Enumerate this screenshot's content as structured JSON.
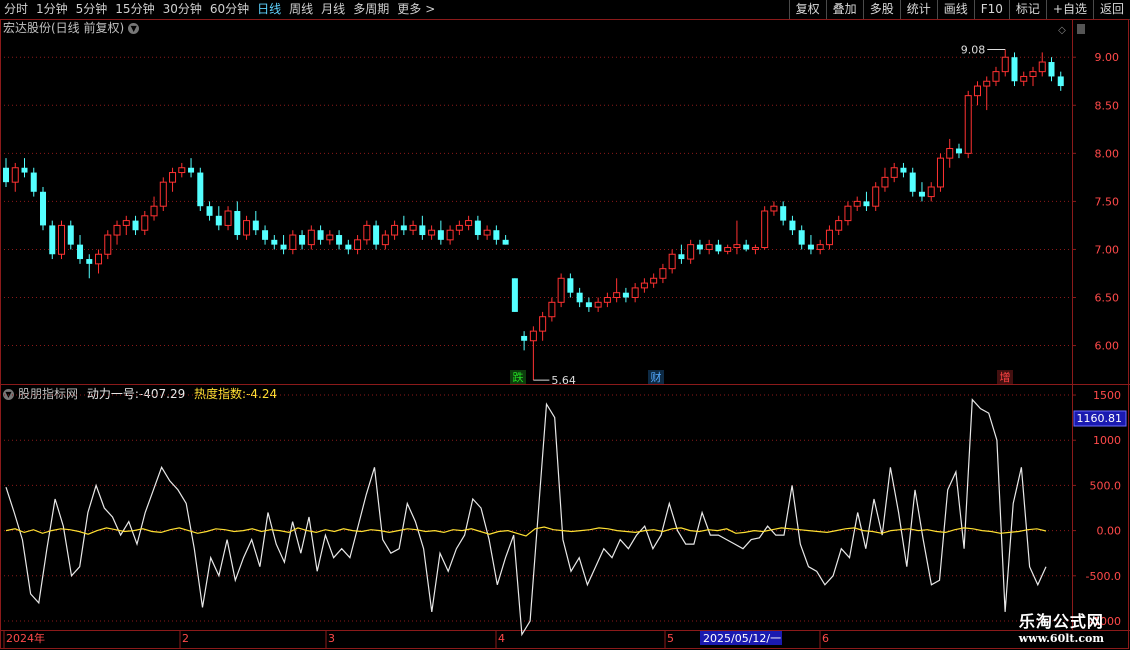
{
  "toolbar": {
    "period_tabs": [
      "分时",
      "1分钟",
      "5分钟",
      "15分钟",
      "30分钟",
      "60分钟",
      "日线",
      "周线",
      "月线",
      "多周期",
      "更多"
    ],
    "active_tab": "日线",
    "more_arrow": ">",
    "right_buttons": [
      "复权",
      "叠加",
      "多股",
      "统计",
      "画线",
      "F10",
      "标记",
      "+自选",
      "返回"
    ]
  },
  "main_panel": {
    "title": "宏达股份(日线 前复权)",
    "high_label": "9.08",
    "low_label": "5.64",
    "markers": [
      {
        "text": "跌",
        "color": "#22dd22",
        "bg": "#0d3d0d"
      },
      {
        "text": "财",
        "color": "#55aaff",
        "bg": "#0d2a44"
      },
      {
        "text": "增",
        "color": "#ff4444",
        "bg": "#441010"
      }
    ],
    "y_ticks": [
      "9.00",
      "8.50",
      "8.00",
      "7.50",
      "7.00",
      "6.50",
      "6.00"
    ]
  },
  "indicator_panel": {
    "name": "股朋指标网",
    "line1_label": "动力一号:",
    "line1_value": "-407.29",
    "line2_label": "热度指数:",
    "line2_value": "-4.24",
    "y_ticks": [
      "1500",
      "1000",
      "500.0",
      "0.00",
      "-500.0",
      "-1000"
    ],
    "cursor_value": "1160.81"
  },
  "time_axis": {
    "labels": [
      "2024年",
      "2",
      "3",
      "4",
      "5",
      "6"
    ],
    "cursor_date": "2025/05/12/一"
  },
  "watermark": {
    "line1": "乐淘公式网",
    "line2": "www.60lt.com"
  },
  "colors": {
    "up": "#ff3232",
    "down": "#54ffff",
    "grid": "#8b1a1a",
    "line1": "#e8e8e8",
    "line2": "#ffe033"
  },
  "chart_data": [
    {
      "type": "candlestick",
      "title": "宏达股份(日线 前复权)",
      "ylim": [
        5.6,
        9.2
      ],
      "y_ticks": [
        6.0,
        6.5,
        7.0,
        7.5,
        8.0,
        8.5,
        9.0
      ],
      "x_labels": [
        "2024年",
        "2",
        "3",
        "4",
        "5",
        "6"
      ],
      "ohlc": [
        [
          7.85,
          7.95,
          7.65,
          7.7
        ],
        [
          7.7,
          7.9,
          7.6,
          7.85
        ],
        [
          7.85,
          7.95,
          7.75,
          7.8
        ],
        [
          7.8,
          7.85,
          7.55,
          7.6
        ],
        [
          7.6,
          7.65,
          7.2,
          7.25
        ],
        [
          7.25,
          7.3,
          6.9,
          6.95
        ],
        [
          6.95,
          7.3,
          6.9,
          7.25
        ],
        [
          7.25,
          7.3,
          7.0,
          7.05
        ],
        [
          7.05,
          7.15,
          6.85,
          6.9
        ],
        [
          6.9,
          6.95,
          6.7,
          6.85
        ],
        [
          6.85,
          7.0,
          6.75,
          6.95
        ],
        [
          6.95,
          7.2,
          6.9,
          7.15
        ],
        [
          7.15,
          7.3,
          7.05,
          7.25
        ],
        [
          7.25,
          7.35,
          7.15,
          7.3
        ],
        [
          7.3,
          7.35,
          7.15,
          7.2
        ],
        [
          7.2,
          7.4,
          7.15,
          7.35
        ],
        [
          7.35,
          7.55,
          7.3,
          7.45
        ],
        [
          7.45,
          7.75,
          7.4,
          7.7
        ],
        [
          7.7,
          7.85,
          7.6,
          7.8
        ],
        [
          7.8,
          7.9,
          7.75,
          7.85
        ],
        [
          7.85,
          7.95,
          7.75,
          7.8
        ],
        [
          7.8,
          7.85,
          7.4,
          7.45
        ],
        [
          7.45,
          7.5,
          7.3,
          7.35
        ],
        [
          7.35,
          7.45,
          7.2,
          7.25
        ],
        [
          7.25,
          7.45,
          7.2,
          7.4
        ],
        [
          7.4,
          7.5,
          7.1,
          7.15
        ],
        [
          7.15,
          7.35,
          7.1,
          7.3
        ],
        [
          7.3,
          7.4,
          7.15,
          7.2
        ],
        [
          7.2,
          7.25,
          7.05,
          7.1
        ],
        [
          7.1,
          7.15,
          7.0,
          7.05
        ],
        [
          7.05,
          7.15,
          6.95,
          7.0
        ],
        [
          7.0,
          7.2,
          6.95,
          7.15
        ],
        [
          7.15,
          7.2,
          7.0,
          7.05
        ],
        [
          7.05,
          7.25,
          7.0,
          7.2
        ],
        [
          7.2,
          7.25,
          7.05,
          7.1
        ],
        [
          7.1,
          7.2,
          7.05,
          7.15
        ],
        [
          7.15,
          7.2,
          7.0,
          7.05
        ],
        [
          7.05,
          7.1,
          6.95,
          7.0
        ],
        [
          7.0,
          7.15,
          6.95,
          7.1
        ],
        [
          7.1,
          7.3,
          7.05,
          7.25
        ],
        [
          7.25,
          7.3,
          7.0,
          7.05
        ],
        [
          7.05,
          7.2,
          7.0,
          7.15
        ],
        [
          7.15,
          7.3,
          7.1,
          7.25
        ],
        [
          7.25,
          7.35,
          7.15,
          7.2
        ],
        [
          7.2,
          7.3,
          7.15,
          7.25
        ],
        [
          7.25,
          7.35,
          7.1,
          7.15
        ],
        [
          7.15,
          7.25,
          7.1,
          7.2
        ],
        [
          7.2,
          7.3,
          7.05,
          7.1
        ],
        [
          7.1,
          7.25,
          7.05,
          7.2
        ],
        [
          7.2,
          7.3,
          7.15,
          7.25
        ],
        [
          7.25,
          7.35,
          7.2,
          7.3
        ],
        [
          7.3,
          7.35,
          7.1,
          7.15
        ],
        [
          7.15,
          7.25,
          7.1,
          7.2
        ],
        [
          7.2,
          7.25,
          7.05,
          7.1
        ],
        [
          7.1,
          7.15,
          7.05,
          7.05
        ],
        [
          6.7,
          6.7,
          6.35,
          6.35
        ],
        [
          6.1,
          6.15,
          5.95,
          6.05
        ],
        [
          6.05,
          6.2,
          5.64,
          6.15
        ],
        [
          6.15,
          6.35,
          6.05,
          6.3
        ],
        [
          6.3,
          6.5,
          6.25,
          6.45
        ],
        [
          6.45,
          6.75,
          6.4,
          6.7
        ],
        [
          6.7,
          6.75,
          6.5,
          6.55
        ],
        [
          6.55,
          6.6,
          6.4,
          6.45
        ],
        [
          6.45,
          6.5,
          6.35,
          6.4
        ],
        [
          6.4,
          6.5,
          6.35,
          6.45
        ],
        [
          6.45,
          6.55,
          6.4,
          6.5
        ],
        [
          6.5,
          6.7,
          6.45,
          6.55
        ],
        [
          6.55,
          6.6,
          6.45,
          6.5
        ],
        [
          6.5,
          6.65,
          6.45,
          6.6
        ],
        [
          6.6,
          6.7,
          6.55,
          6.65
        ],
        [
          6.65,
          6.75,
          6.6,
          6.7
        ],
        [
          6.7,
          6.85,
          6.65,
          6.8
        ],
        [
          6.8,
          7.0,
          6.75,
          6.95
        ],
        [
          6.95,
          7.05,
          6.85,
          6.9
        ],
        [
          6.9,
          7.1,
          6.85,
          7.05
        ],
        [
          7.05,
          7.1,
          6.95,
          7.0
        ],
        [
          7.0,
          7.1,
          6.95,
          7.05
        ],
        [
          7.05,
          7.1,
          6.95,
          6.98
        ],
        [
          6.98,
          7.05,
          6.95,
          7.02
        ],
        [
          7.02,
          7.3,
          6.95,
          7.05
        ],
        [
          7.05,
          7.1,
          6.98,
          7.0
        ],
        [
          7.0,
          7.05,
          6.95,
          7.02
        ],
        [
          7.02,
          7.45,
          7.0,
          7.4
        ],
        [
          7.4,
          7.5,
          7.35,
          7.45
        ],
        [
          7.45,
          7.5,
          7.25,
          7.3
        ],
        [
          7.3,
          7.35,
          7.15,
          7.2
        ],
        [
          7.2,
          7.25,
          7.0,
          7.05
        ],
        [
          7.05,
          7.15,
          6.95,
          7.0
        ],
        [
          7.0,
          7.1,
          6.95,
          7.05
        ],
        [
          7.05,
          7.25,
          7.0,
          7.2
        ],
        [
          7.2,
          7.35,
          7.15,
          7.3
        ],
        [
          7.3,
          7.5,
          7.25,
          7.45
        ],
        [
          7.45,
          7.55,
          7.4,
          7.5
        ],
        [
          7.5,
          7.6,
          7.4,
          7.45
        ],
        [
          7.45,
          7.7,
          7.4,
          7.65
        ],
        [
          7.65,
          7.85,
          7.6,
          7.75
        ],
        [
          7.75,
          7.9,
          7.7,
          7.85
        ],
        [
          7.85,
          7.9,
          7.75,
          7.8
        ],
        [
          7.8,
          7.85,
          7.55,
          7.6
        ],
        [
          7.6,
          7.7,
          7.5,
          7.55
        ],
        [
          7.55,
          7.7,
          7.5,
          7.65
        ],
        [
          7.65,
          8.0,
          7.6,
          7.95
        ],
        [
          7.95,
          8.15,
          7.85,
          8.05
        ],
        [
          8.05,
          8.1,
          7.95,
          8.0
        ],
        [
          8.0,
          8.65,
          7.95,
          8.6
        ],
        [
          8.6,
          8.75,
          8.5,
          8.7
        ],
        [
          8.7,
          8.8,
          8.45,
          8.75
        ],
        [
          8.75,
          8.9,
          8.7,
          8.85
        ],
        [
          8.85,
          9.08,
          8.8,
          9.0
        ],
        [
          9.0,
          9.05,
          8.7,
          8.75
        ],
        [
          8.75,
          8.85,
          8.7,
          8.8
        ],
        [
          8.8,
          8.9,
          8.7,
          8.85
        ],
        [
          8.85,
          9.05,
          8.8,
          8.95
        ],
        [
          8.95,
          9.0,
          8.75,
          8.8
        ],
        [
          8.8,
          8.85,
          8.65,
          8.7
        ]
      ]
    },
    {
      "type": "line",
      "title": "股朋指标网",
      "ylim": [
        -1100,
        1600
      ],
      "y_ticks": [
        1500,
        1000,
        500,
        0,
        -500,
        -1000
      ],
      "series": [
        {
          "name": "动力一号",
          "values": [
            480,
            200,
            -100,
            -700,
            -800,
            -200,
            350,
            50,
            -500,
            -400,
            200,
            500,
            250,
            150,
            -50,
            100,
            -150,
            200,
            450,
            700,
            550,
            450,
            300,
            -200,
            -850,
            -300,
            -500,
            -100,
            -550,
            -300,
            -100,
            -400,
            200,
            -150,
            -350,
            100,
            -250,
            150,
            -450,
            -50,
            -300,
            -200,
            -300,
            50,
            400,
            700,
            -100,
            -250,
            -200,
            300,
            100,
            -200,
            -900,
            -250,
            -450,
            -200,
            -50,
            350,
            250,
            -100,
            -600,
            -300,
            -50,
            -1150,
            -1000,
            200,
            1400,
            1250,
            -100,
            -450,
            -300,
            -600,
            -400,
            -200,
            -300,
            -100,
            -200,
            -50,
            50,
            -200,
            -50,
            300,
            0,
            -150,
            -150,
            200,
            -50,
            -50,
            -100,
            -150,
            -200,
            -100,
            -80,
            50,
            -50,
            -50,
            500,
            -150,
            -400,
            -450,
            -600,
            -500,
            -200,
            -300,
            200,
            -200,
            350,
            -50,
            700,
            200,
            -400,
            450,
            -100,
            -600,
            -550,
            450,
            650,
            -200,
            1450,
            1350,
            1300,
            1000,
            -900,
            300,
            700,
            -400,
            -600,
            -400
          ]
        },
        {
          "name": "热度指数",
          "values": [
            0,
            20,
            -20,
            10,
            -30,
            0,
            20,
            10,
            -10,
            -40,
            0,
            30,
            10,
            -10,
            0,
            20,
            -10,
            -20,
            10,
            30,
            0,
            -30,
            -10,
            20,
            10,
            -10,
            0,
            20,
            -10,
            10,
            0,
            -20,
            30,
            0,
            -20,
            10,
            -10,
            20,
            0,
            -10,
            10,
            0,
            -20,
            0,
            20,
            10,
            -10,
            0,
            -20,
            10,
            0,
            20,
            -10,
            -40,
            -10,
            0,
            -30,
            -60,
            20,
            40,
            10,
            0,
            -10,
            0,
            10,
            30,
            20,
            0,
            -10,
            -20,
            0,
            10,
            -10,
            20,
            30,
            0,
            -10,
            10,
            0,
            20,
            -30,
            -20,
            0,
            -10,
            10,
            30,
            20,
            10,
            0,
            -10,
            -20,
            0,
            20,
            30,
            0,
            -10,
            -30,
            0,
            10,
            20,
            0,
            10,
            -10,
            -20,
            10,
            30,
            20,
            0,
            -10,
            -30,
            -20,
            -10,
            10,
            20,
            -4
          ]
        }
      ]
    }
  ]
}
